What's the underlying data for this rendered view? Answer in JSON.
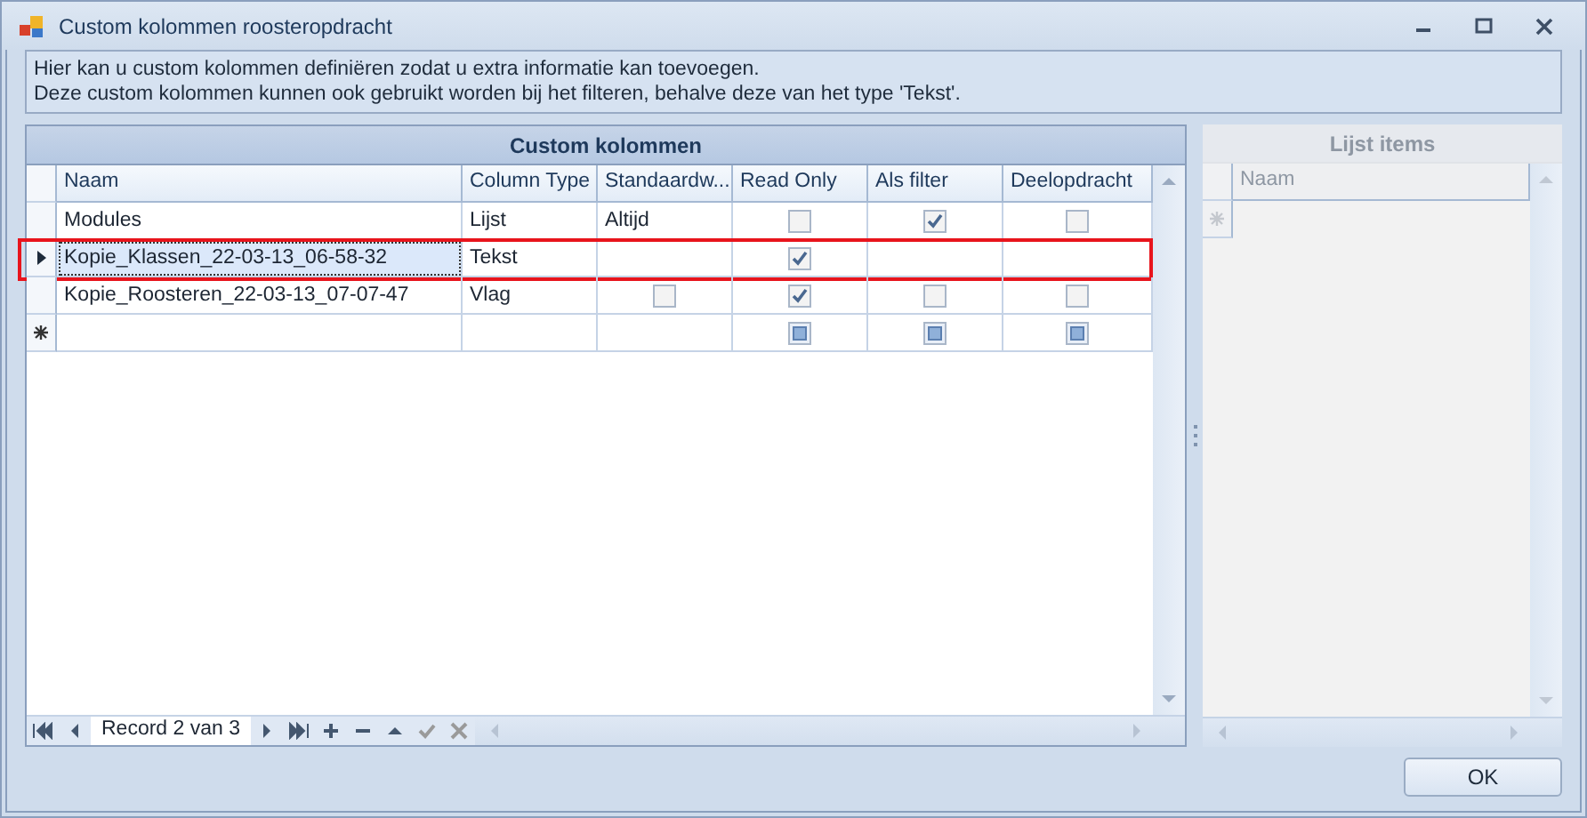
{
  "window": {
    "title": "Custom kolommen roosteropdracht"
  },
  "info": [
    "Hier kan u custom kolommen definiëren zodat u extra informatie kan toevoegen.",
    "Deze custom kolommen kunnen ook gebruikt worden bij het filteren, behalve deze van het type 'Tekst'."
  ],
  "grid": {
    "title": "Custom kolommen",
    "columns": [
      "Naam",
      "Column Type",
      "Standaardw...",
      "Read Only",
      "Als filter",
      "Deelopdracht"
    ],
    "rows": [
      {
        "selected": false,
        "new": false,
        "highlighted": false,
        "cells": [
          {
            "kind": "text",
            "text": "Modules"
          },
          {
            "kind": "text",
            "text": "Lijst"
          },
          {
            "kind": "text",
            "text": "Altijd"
          },
          {
            "kind": "check",
            "checked": false
          },
          {
            "kind": "check",
            "checked": true
          },
          {
            "kind": "check",
            "checked": false
          }
        ]
      },
      {
        "selected": true,
        "new": false,
        "highlighted": true,
        "cells": [
          {
            "kind": "text",
            "text": "Kopie_Klassen_22-03-13_06-58-32"
          },
          {
            "kind": "text",
            "text": "Tekst"
          },
          {
            "kind": "empty"
          },
          {
            "kind": "check",
            "checked": true
          },
          {
            "kind": "empty"
          },
          {
            "kind": "empty"
          }
        ]
      },
      {
        "selected": false,
        "new": false,
        "highlighted": false,
        "cells": [
          {
            "kind": "text",
            "text": "Kopie_Roosteren_22-03-13_07-07-47"
          },
          {
            "kind": "text",
            "text": "Vlag"
          },
          {
            "kind": "check",
            "checked": false
          },
          {
            "kind": "check",
            "checked": true
          },
          {
            "kind": "check",
            "checked": false
          },
          {
            "kind": "check",
            "checked": false
          }
        ]
      },
      {
        "selected": false,
        "new": true,
        "highlighted": false,
        "cells": [
          {
            "kind": "empty"
          },
          {
            "kind": "empty"
          },
          {
            "kind": "empty"
          },
          {
            "kind": "blank-check"
          },
          {
            "kind": "blank-check"
          },
          {
            "kind": "blank-check"
          }
        ]
      }
    ],
    "navigator": {
      "record": "Record 2 van 3"
    }
  },
  "list_panel": {
    "title": "Lijst items",
    "columns": [
      "Naam"
    ],
    "disabled": true
  },
  "buttons": [
    "OK"
  ]
}
